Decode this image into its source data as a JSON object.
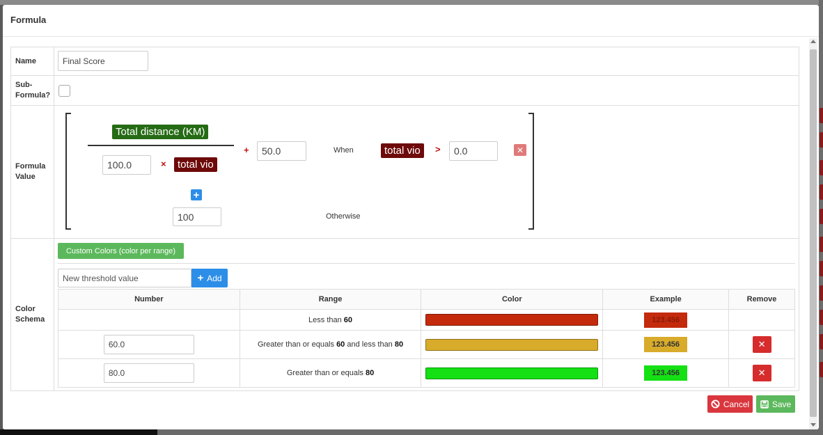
{
  "modal": {
    "title": "Formula"
  },
  "fields": {
    "name_label": "Name",
    "name_value": "Final Score",
    "subformula_label": "Sub-Formula?",
    "subformula_checked": false,
    "formula_label": "Formula Value",
    "color_label": "Color Schema"
  },
  "formula": {
    "numerator": "Total distance (KM)",
    "multiplier": "100.0",
    "times_symbol": "×",
    "variable": "total vio",
    "plus_symbol": "+",
    "offset": "50.0",
    "when_label": "When",
    "condition_var": "total vio",
    "condition_op": ">",
    "condition_value": "0.0",
    "otherwise_value": "100",
    "otherwise_label": "Otherwise",
    "colors": {
      "variable_bg": "#256b15",
      "tag_bg": "#6e0a0a",
      "operator": "#c01010"
    }
  },
  "color_schema": {
    "mode_button": "Custom Colors (color per range)",
    "threshold_placeholder": "New threshold value",
    "add_label": "Add",
    "columns": [
      "Number",
      "Range",
      "Color",
      "Example",
      "Remove"
    ],
    "rows": [
      {
        "number": "",
        "range_prefix": "Less than ",
        "range_a": "60",
        "range_mid": "",
        "range_b": "",
        "color": "#c42a0c",
        "example": "123.456",
        "removable": false
      },
      {
        "number": "60.0",
        "range_prefix": "Greater than or equals ",
        "range_a": "60",
        "range_mid": " and less than ",
        "range_b": "80",
        "color": "#d8ab2a",
        "example": "123.456",
        "removable": true
      },
      {
        "number": "80.0",
        "range_prefix": "Greater than or equals ",
        "range_a": "80",
        "range_mid": "",
        "range_b": "",
        "color": "#14e014",
        "example": "123.456",
        "removable": true
      }
    ]
  },
  "footer": {
    "cancel_label": "Cancel",
    "save_label": "Save"
  }
}
